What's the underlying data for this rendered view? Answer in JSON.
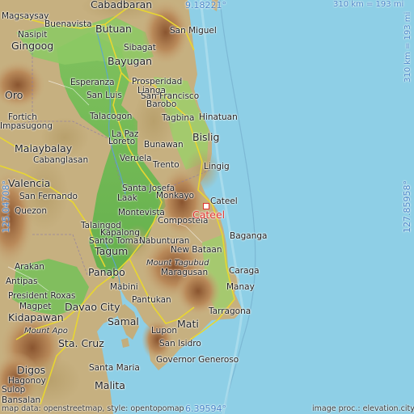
{
  "marker_place": "Cateel",
  "coords": {
    "lat_top": "9.18221°",
    "lat_bottom": "6.39594°",
    "lon_left": "125.04708°",
    "lon_right": "127.85958°"
  },
  "scale": {
    "top": "310 km = 193 mi",
    "right": "310 km = 193 mi"
  },
  "attribution": {
    "left": "map data: openstreetmap, style: opentopomap",
    "right": "image proc.: elevation.city"
  },
  "places": {
    "cabadbaran": "Cabadbaran",
    "magsaysay": "Magsaysay",
    "buenavista": "Buenavista",
    "butuan": "Butuan",
    "san_miguel": "San Miguel",
    "nasipit": "Nasipit",
    "gingoog": "Gingoog",
    "sibagat": "Sibagat",
    "bayugan": "Bayugan",
    "oro": "Oro",
    "esperanza": "Esperanza",
    "prosperidad": "Prosperidad",
    "lianga": "Lianga",
    "san_luis": "San Luis",
    "san_francisco": "San Francisco",
    "barobo": "Barobo",
    "hinatuan": "Hinatuan",
    "fortich": "Fortich",
    "talacogon": "Talacogon",
    "tagbina": "Tagbina",
    "impasugong": "Impasugong",
    "la_paz": "La Paz",
    "loreto": "Loreto",
    "bislig": "Bislig",
    "malaybalay": "Malaybalay",
    "cabanglasan": "Cabanglasan",
    "bunawan": "Bunawan",
    "lingig": "Lingig",
    "veruela": "Veruela",
    "trento": "Trento",
    "valencia": "Valencia",
    "santa_josefa": "Santa Josefa",
    "monkayo": "Monkayo",
    "cateel": "Cateel",
    "san_fernando": "San Fernando",
    "laak": "Laak",
    "quezon": "Quezon",
    "montevista": "Montevista",
    "compostela": "Compostela",
    "talaingod": "Talaingod",
    "kapalong": "Kapalong",
    "baganga": "Baganga",
    "santo_tomas": "Santo Tomas",
    "nabunturan": "Nabunturan",
    "new_bataan": "New Bataan",
    "tagum": "Tagum",
    "mount_tagubud": "Mount Tagubud",
    "arakan": "Arakan",
    "maragusan": "Maragusan",
    "caraga": "Caraga",
    "antipas": "Antipas",
    "panabo": "Panabo",
    "manay": "Manay",
    "president_roxas": "President Roxas",
    "mabini": "Mabini",
    "pantukan": "Pantukan",
    "magpet": "Magpet",
    "davao_city": "Davao City",
    "tarragona": "Tarragona",
    "kidapawan": "Kidapawan",
    "samal": "Samal",
    "mati": "Mati",
    "mount_apo": "Mount Apo",
    "lupon": "Lupon",
    "sta_cruz": "Sta. Cruz",
    "san_isidro": "San Isidro",
    "governor_generoso": "Governor Generoso",
    "digos": "Digos",
    "santa_maria": "Santa Maria",
    "hagonoy": "Hagonoy",
    "malita": "Malita",
    "sulop": "Sulop",
    "bansalan": "Bansalan"
  }
}
